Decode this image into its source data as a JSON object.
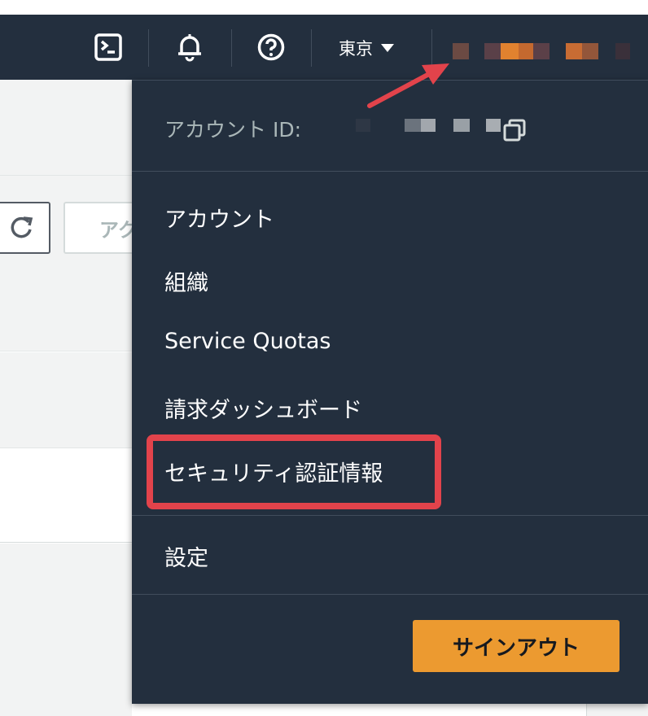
{
  "navbar": {
    "icons": [
      "cloudshell-icon",
      "bell-icon",
      "help-icon"
    ],
    "region_label": "東京"
  },
  "background": {
    "action_button_label": "アク"
  },
  "dropdown": {
    "account_id_label": "アカウント ID:",
    "menu_items": [
      "アカウント",
      "組織",
      "Service Quotas",
      "請求ダッシュボード",
      "セキュリティ認証情報",
      "設定"
    ],
    "signout_label": "サインアウト"
  },
  "colors": {
    "nav_bg": "#232f3e",
    "highlight": "#e2434b",
    "signout_bg": "#ec9a30",
    "arrow": "#e2434b"
  }
}
